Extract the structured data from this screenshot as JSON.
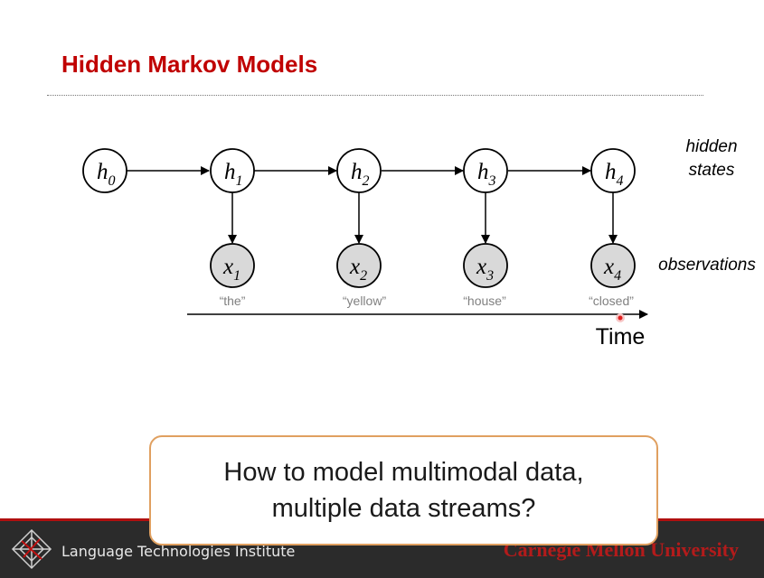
{
  "slide": {
    "title": "Hidden Markov Models",
    "callout": "How to model multimodal data,\nmultiple data streams?"
  },
  "diagram": {
    "hidden_nodes": [
      {
        "var": "h",
        "sub": "0"
      },
      {
        "var": "h",
        "sub": "1"
      },
      {
        "var": "h",
        "sub": "2"
      },
      {
        "var": "h",
        "sub": "3"
      },
      {
        "var": "h",
        "sub": "4"
      }
    ],
    "observed_nodes": [
      {
        "var": "x",
        "sub": "1",
        "word": "“the”"
      },
      {
        "var": "x",
        "sub": "2",
        "word": "“yellow”"
      },
      {
        "var": "x",
        "sub": "3",
        "word": "“house”"
      },
      {
        "var": "x",
        "sub": "4",
        "word": "“closed”"
      }
    ],
    "label_hidden_line1": "hidden",
    "label_hidden_line2": "states",
    "label_observations": "observations",
    "time_label": "Time"
  },
  "footer": {
    "institute": "Language Technologies Institute",
    "university": "Carnegie Mellon University"
  },
  "colors": {
    "title": "#c00000",
    "observed_fill": "#d9d9d9",
    "footer_bg": "#2b2b2b",
    "callout_border": "#e0a060"
  }
}
